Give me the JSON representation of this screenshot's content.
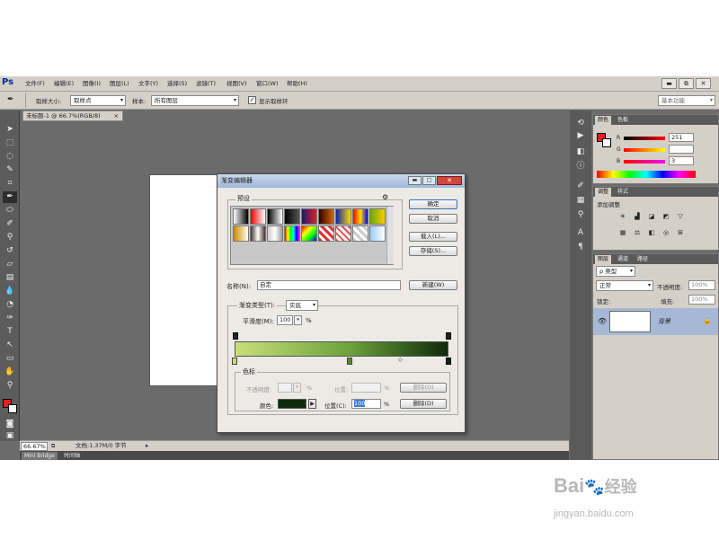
{
  "app": {
    "logo": "Ps",
    "menus": [
      "文件(F)",
      "编辑(E)",
      "图像(I)",
      "图层(L)",
      "文字(Y)",
      "选择(S)",
      "滤镜(T)",
      "视图(V)",
      "窗口(W)",
      "帮助(H)"
    ],
    "window_buttons": [
      "▬",
      "⧉",
      "✕"
    ]
  },
  "options": {
    "sample_size_label": "取样大小:",
    "sample_size_value": "取样点",
    "sample_label": "样本:",
    "sample_value": "所有图层",
    "show_ring_label": "显示取样环",
    "workspace": "基本功能"
  },
  "document": {
    "tab_title": "未标题-1 @ 66.7%(RGB/8)",
    "tab_close": "×",
    "zoom": "66.67%",
    "doc_info": "文档:1.37M/0 字节"
  },
  "bottom_tabs": [
    "Mini Bridge",
    "时间轴"
  ],
  "color_panel": {
    "tabs": [
      "颜色",
      "色板"
    ],
    "r": "251",
    "g": "",
    "b": "3",
    "foreground": "#ee1c1c",
    "background": "#ffffff"
  },
  "adjust_panel": {
    "tabs": [
      "调整",
      "样式"
    ],
    "add_label": "添加调整"
  },
  "layers_panel": {
    "tabs": [
      "图层",
      "通道",
      "路径"
    ],
    "kind": "ρ 类型",
    "blend_mode": "正常",
    "opacity_label": "不透明度:",
    "opacity": "100%",
    "lock_label": "锁定:",
    "fill_label": "填充:",
    "fill": "100%",
    "layer_name": "背景"
  },
  "dialog": {
    "title": "渐变编辑器",
    "presets_label": "预设",
    "ok": "确定",
    "cancel": "取消",
    "load": "载入(L)...",
    "save": "存储(S)...",
    "name_label": "名称(N):",
    "name_value": "自定",
    "new_button": "新建(W)",
    "gradient_type_label": "渐变类型(T):",
    "gradient_type_value": "实底",
    "smoothness_label": "平滑度(M):",
    "smoothness_value": "100",
    "smoothness_unit": "%",
    "stops_label": "色标",
    "opacity_label": "不透明度:",
    "opacity_unit": "%",
    "location_label": "位置:",
    "location_unit": "%",
    "delete_button": "删除(D)",
    "color_label": "颜色:",
    "color_location_label": "位置(C):",
    "color_location_value": "100",
    "color_location_unit": "%",
    "delete_button_2": "删除(D)",
    "stop_color": "#0f2a0a",
    "gradient_start": "#c8de78",
    "gradient_end": "#0f2a0a"
  },
  "watermark": {
    "brand": "Bai",
    "brand2": "经验",
    "url": "jingyan.baidu.com"
  }
}
